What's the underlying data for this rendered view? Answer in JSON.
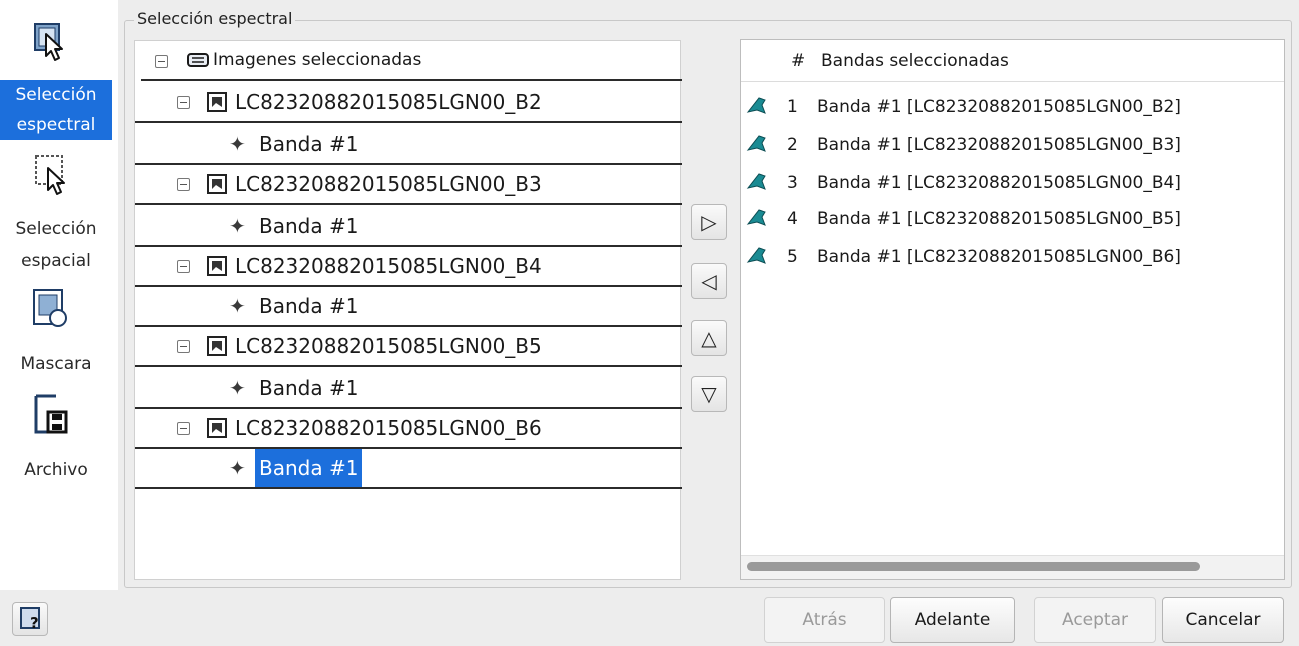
{
  "nav": {
    "items": [
      {
        "label_line1": "Selección",
        "label_line2": "espectral",
        "icon": "select-cursor-icon",
        "active": true
      },
      {
        "label_line1": "Selección",
        "label_line2": "espacial",
        "icon": "area-select-icon",
        "active": false
      },
      {
        "label_line1": "Mascara",
        "icon": "mask-icon",
        "active": false
      },
      {
        "label_line1": "Archivo",
        "icon": "save-file-icon",
        "active": false
      }
    ]
  },
  "group": {
    "title": "Selección espectral"
  },
  "tree": {
    "root_label": "Imagenes seleccionadas",
    "images": [
      {
        "name": "LC82320882015085LGN00_B2",
        "band": "Banda #1"
      },
      {
        "name": "LC82320882015085LGN00_B3",
        "band": "Banda #1"
      },
      {
        "name": "LC82320882015085LGN00_B4",
        "band": "Banda #1"
      },
      {
        "name": "LC82320882015085LGN00_B5",
        "band": "Banda #1"
      },
      {
        "name": "LC82320882015085LGN00_B6",
        "band": "Banda #1"
      }
    ],
    "selected_band_index": 4
  },
  "move_buttons": [
    {
      "symbol": "▷",
      "icon": "add-right-icon"
    },
    {
      "symbol": "◁",
      "icon": "remove-left-icon"
    },
    {
      "symbol": "△",
      "icon": "move-up-icon"
    },
    {
      "symbol": "▽",
      "icon": "move-down-icon"
    }
  ],
  "list": {
    "header_hash": "#",
    "header_title": "Bandas seleccionadas",
    "rows": [
      {
        "num": "1",
        "label": "Banda #1 [LC82320882015085LGN00_B2]"
      },
      {
        "num": "2",
        "label": "Banda #1 [LC82320882015085LGN00_B3]"
      },
      {
        "num": "3",
        "label": "Banda #1 [LC82320882015085LGN00_B4]"
      },
      {
        "num": "4",
        "label": "Banda #1 [LC82320882015085LGN00_B5]"
      },
      {
        "num": "5",
        "label": "Banda #1 [LC82320882015085LGN00_B6]"
      }
    ]
  },
  "buttons": {
    "back": "Atrás",
    "next": "Adelante",
    "accept": "Aceptar",
    "cancel": "Cancelar"
  },
  "colors": {
    "accent": "#1c6fdc",
    "band_icon_teal": "#1a8b93"
  }
}
